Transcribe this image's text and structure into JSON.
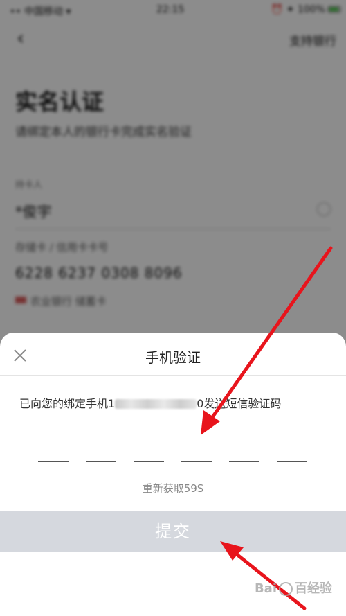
{
  "background": {
    "status_bar": {
      "carrier": "•• 中国移动 ▾",
      "time": "22:15",
      "right": "⏰ ✦ 100%"
    },
    "nav": {
      "back_icon": "chevron-left-icon",
      "right_label": "支持银行"
    },
    "title": "实名认证",
    "subtitle": "请绑定本人的银行卡完成实名验证",
    "name_label": "持卡人",
    "name_value": "*俊宇",
    "card_label": "存储卡 / 信用卡卡号",
    "card_value": "6228 6237 0308 8096",
    "bank_name": "农业银行 储蓄卡"
  },
  "sheet": {
    "close_icon": "close-icon",
    "title": "手机验证",
    "desc_prefix": "已向您的绑定手机1",
    "desc_suffix": "0发送短信验证码",
    "code_slots": 6,
    "resend": "重新获取59S",
    "submit": "提交"
  },
  "colors": {
    "arrow": "#e8141c",
    "submit_bg": "#d5d8de",
    "dim": "rgba(0,0,0,0.42)"
  },
  "watermark": {
    "text": "Bai百经验"
  }
}
